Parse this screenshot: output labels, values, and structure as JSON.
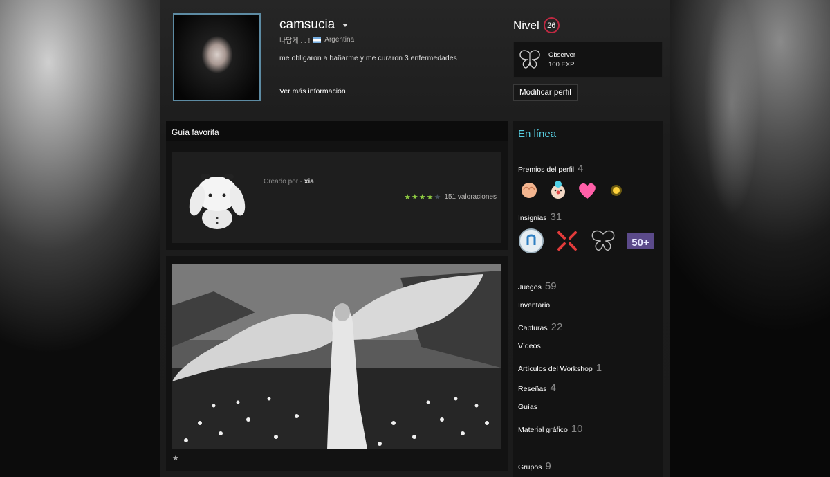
{
  "profile": {
    "persona_name": "camsucia",
    "real_name": "나답게 . . !",
    "country": "Argentina",
    "summary": "me obligaron a bañarme y me curaron 3 enfermedades",
    "more_info": "Ver más información"
  },
  "level": {
    "label": "Nivel",
    "value": "26"
  },
  "favorite_badge": {
    "name": "Observer",
    "xp": "100 EXP"
  },
  "edit_button": "Modificar perfil",
  "guide_showcase": {
    "header": "Guía favorita",
    "created_by_label": "Creado por -",
    "author": "xia",
    "ratings_text": "151 valoraciones",
    "stars_filled": 4,
    "stars_total": 5
  },
  "status": "En línea",
  "sidebar": {
    "awards": {
      "label": "Premios del perfil",
      "count": "4"
    },
    "badges": {
      "label": "Insignias",
      "count": "31"
    },
    "badge_50_text": "50+",
    "links": [
      {
        "label": "Juegos",
        "count": "59"
      },
      {
        "label": "Inventario",
        "count": ""
      },
      {
        "label": "Capturas",
        "count": "22"
      },
      {
        "label": "Vídeos",
        "count": ""
      },
      {
        "label": "Artículos del Workshop",
        "count": "1"
      },
      {
        "label": "Reseñas",
        "count": "4"
      },
      {
        "label": "Guías",
        "count": ""
      },
      {
        "label": "Material gráfico",
        "count": "10"
      }
    ],
    "groups": {
      "label": "Grupos",
      "count": "9"
    }
  },
  "icons": {
    "caret": "chevron-down-icon",
    "flag": "argentina-flag-icon",
    "favorite_badge": "butterfly-icon",
    "screenshot_star": "star-icon"
  }
}
